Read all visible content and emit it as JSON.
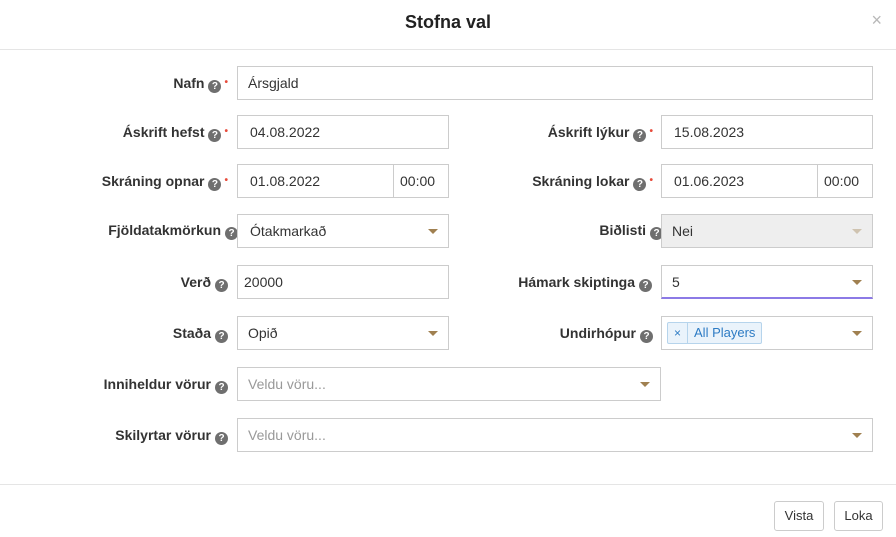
{
  "dialog": {
    "title": "Stofna val",
    "close_glyph": "×"
  },
  "help_glyph": "?",
  "required_glyph": "•",
  "fields": {
    "nafn": {
      "label": "Nafn",
      "value": "Ársgjald"
    },
    "askrift_hefst": {
      "label": "Áskrift hefst",
      "value": "04.08.2022"
    },
    "askrift_lykur": {
      "label": "Áskrift lýkur",
      "value": "15.08.2023"
    },
    "skraning_opnar": {
      "label": "Skráning opnar",
      "date": "01.08.2022",
      "time": "00:00"
    },
    "skraning_lokar": {
      "label": "Skráning lokar",
      "date": "01.06.2023",
      "time": "00:00"
    },
    "fjoldatakmorkun": {
      "label": "Fjöldatakmörkun",
      "value": "Ótakmarkað"
    },
    "bidlisti": {
      "label": "Biðlisti",
      "value": "Nei"
    },
    "verd": {
      "label": "Verð",
      "value": "20000"
    },
    "hamark_skiptinga": {
      "label": "Hámark skiptinga",
      "value": "5"
    },
    "stada": {
      "label": "Staða",
      "value": "Opið"
    },
    "undirhopur": {
      "label": "Undirhópur",
      "tag": "All Players",
      "tag_remove": "×"
    },
    "inniheldur_vorur": {
      "label": "Inniheldur vörur",
      "placeholder": "Veldu vöru..."
    },
    "skilyrtar_vorur": {
      "label": "Skilyrtar vörur",
      "placeholder": "Veldu vöru..."
    }
  },
  "footer": {
    "save_label": "Vista",
    "close_label": "Loka"
  },
  "colors": {
    "caret": "#a08050",
    "required": "#e74c3c",
    "tag_text": "#2d7bc4",
    "focus_underline": "#8c7ae6"
  }
}
